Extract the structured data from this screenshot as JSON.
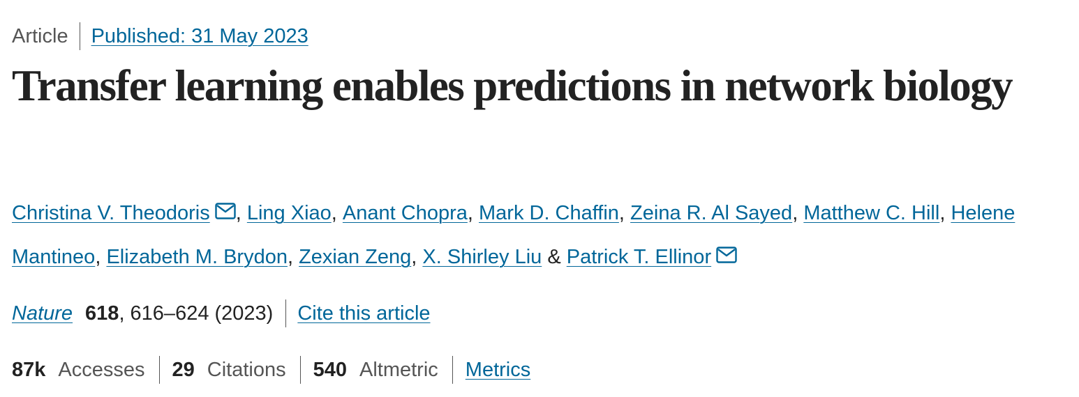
{
  "header": {
    "article_type": "Article",
    "published_label": "Published: 31 May 2023"
  },
  "title": "Transfer learning enables predictions in network biology",
  "authors": [
    {
      "name": "Christina V. Theodoris",
      "separator": ", "
    },
    {
      "name": "Ling Xiao",
      "separator": ", "
    },
    {
      "name": "Anant Chopra",
      "separator": ", "
    },
    {
      "name": "Mark D. Chaffin",
      "separator": ", "
    },
    {
      "name": "Zeina R. Al Sayed",
      "separator": ", "
    },
    {
      "name": "Matthew C. Hill",
      "separator": ", "
    },
    {
      "name": "Helene Mantineo",
      "separator": ", "
    },
    {
      "name": "Elizabeth M. Brydon",
      "separator": ", "
    },
    {
      "name": "Zexian Zeng",
      "separator": ", "
    },
    {
      "name": "X. Shirley Liu",
      "separator": " & "
    },
    {
      "name": "Patrick T. Ellinor",
      "separator": ""
    }
  ],
  "citation": {
    "journal": "Nature",
    "volume": "618",
    "pages_year": ", 616–624 (2023)",
    "cite_label": "Cite this article"
  },
  "metrics": {
    "accesses_value": "87k",
    "accesses_label": "Accesses",
    "citations_value": "29",
    "citations_label": "Citations",
    "altmetric_value": "540",
    "altmetric_label": "Altmetric",
    "metrics_link": "Metrics"
  },
  "colors": {
    "link": "#006699",
    "text": "#222222",
    "muted": "#555555"
  },
  "icons": {
    "corresponding_author": "envelope-icon"
  }
}
